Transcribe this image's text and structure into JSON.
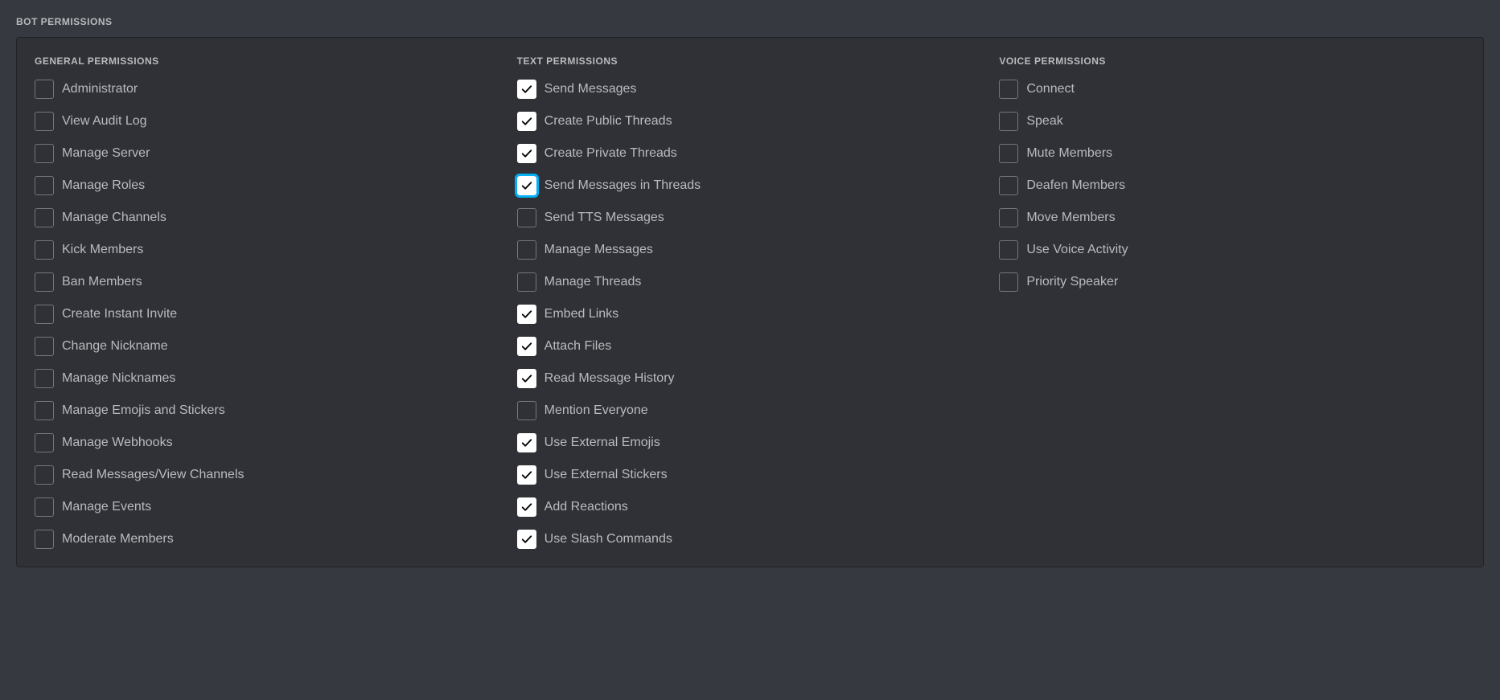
{
  "section_title": "BOT PERMISSIONS",
  "columns": [
    {
      "header": "GENERAL PERMISSIONS",
      "name": "general",
      "items": [
        {
          "label": "Administrator",
          "checked": false,
          "focused": false
        },
        {
          "label": "View Audit Log",
          "checked": false,
          "focused": false
        },
        {
          "label": "Manage Server",
          "checked": false,
          "focused": false
        },
        {
          "label": "Manage Roles",
          "checked": false,
          "focused": false
        },
        {
          "label": "Manage Channels",
          "checked": false,
          "focused": false
        },
        {
          "label": "Kick Members",
          "checked": false,
          "focused": false
        },
        {
          "label": "Ban Members",
          "checked": false,
          "focused": false
        },
        {
          "label": "Create Instant Invite",
          "checked": false,
          "focused": false
        },
        {
          "label": "Change Nickname",
          "checked": false,
          "focused": false
        },
        {
          "label": "Manage Nicknames",
          "checked": false,
          "focused": false
        },
        {
          "label": "Manage Emojis and Stickers",
          "checked": false,
          "focused": false
        },
        {
          "label": "Manage Webhooks",
          "checked": false,
          "focused": false
        },
        {
          "label": "Read Messages/View Channels",
          "checked": false,
          "focused": false
        },
        {
          "label": "Manage Events",
          "checked": false,
          "focused": false
        },
        {
          "label": "Moderate Members",
          "checked": false,
          "focused": false
        }
      ]
    },
    {
      "header": "TEXT PERMISSIONS",
      "name": "text",
      "items": [
        {
          "label": "Send Messages",
          "checked": true,
          "focused": false
        },
        {
          "label": "Create Public Threads",
          "checked": true,
          "focused": false
        },
        {
          "label": "Create Private Threads",
          "checked": true,
          "focused": false
        },
        {
          "label": "Send Messages in Threads",
          "checked": true,
          "focused": true
        },
        {
          "label": "Send TTS Messages",
          "checked": false,
          "focused": false
        },
        {
          "label": "Manage Messages",
          "checked": false,
          "focused": false
        },
        {
          "label": "Manage Threads",
          "checked": false,
          "focused": false
        },
        {
          "label": "Embed Links",
          "checked": true,
          "focused": false
        },
        {
          "label": "Attach Files",
          "checked": true,
          "focused": false
        },
        {
          "label": "Read Message History",
          "checked": true,
          "focused": false
        },
        {
          "label": "Mention Everyone",
          "checked": false,
          "focused": false
        },
        {
          "label": "Use External Emojis",
          "checked": true,
          "focused": false
        },
        {
          "label": "Use External Stickers",
          "checked": true,
          "focused": false
        },
        {
          "label": "Add Reactions",
          "checked": true,
          "focused": false
        },
        {
          "label": "Use Slash Commands",
          "checked": true,
          "focused": false
        }
      ]
    },
    {
      "header": "VOICE PERMISSIONS",
      "name": "voice",
      "items": [
        {
          "label": "Connect",
          "checked": false,
          "focused": false
        },
        {
          "label": "Speak",
          "checked": false,
          "focused": false
        },
        {
          "label": "Mute Members",
          "checked": false,
          "focused": false
        },
        {
          "label": "Deafen Members",
          "checked": false,
          "focused": false
        },
        {
          "label": "Move Members",
          "checked": false,
          "focused": false
        },
        {
          "label": "Use Voice Activity",
          "checked": false,
          "focused": false
        },
        {
          "label": "Priority Speaker",
          "checked": false,
          "focused": false
        }
      ]
    }
  ]
}
